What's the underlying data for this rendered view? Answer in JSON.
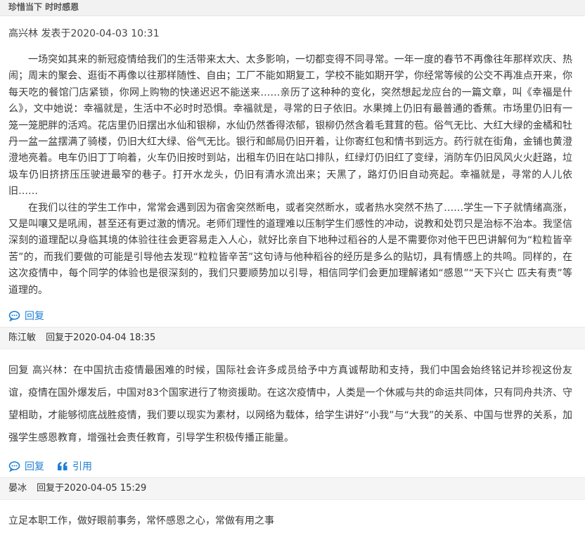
{
  "topic": {
    "title": "珍惜当下 时时感恩"
  },
  "post": {
    "author": "高兴林",
    "meta": "发表于2020-04-03 10:31",
    "paragraphs": [
      "一场突如其来的新冠疫情给我们的生活带来太大、太多影响，一切都变得不同寻常。一年一度的春节不再像往年那样欢庆、热闹；周末的聚会、逛街不再像以往那样随性、自由；工厂不能如期复工，学校不能如期开学，你经常等候的公交不再准点开来，你每天吃的餐馆门店紧锁，你网上购物的快递迟迟不能送来……亲历了这种种的变化，突然想起龙应台的一篇文章，叫《幸福是什么》，文中她说：幸福就是，生活中不必时时恐惧。幸福就是，寻常的日子依旧。水果摊上仍旧有最普通的香蕉。市场里仍旧有一笼一笼肥胖的活鸡。花店里仍旧摆出水仙和银柳，水仙仍然香得浓郁，银柳仍然含着毛茸茸的苞。俗气无比、大红大绿的金橘和牡丹一盆一盆摆满了骑楼，仍旧大红大绿、俗气无比。银行和邮局仍旧开着，让你寄红包和情书到远方。药行就在街角，金铺也黄澄澄地亮着。电车仍旧丁丁响着，火车仍旧按时到站，出租车仍旧在站口排队，红绿灯仍旧红了变绿，消防车仍旧风风火火赶路，垃圾车仍旧挤挤压压驶进最窄的巷子。打开水龙头，仍旧有清水流出来；天黑了，路灯仍旧自动亮起。幸福就是，寻常的人儿依旧……",
      "在我们以往的学生工作中，常常会遇到因为宿舍突然断电，或者突然断水，或者热水突然不热了……学生一下子就情绪高涨，又是叫嚷又是吼闹，甚至还有更过激的情况。老师们理性的道理难以压制学生们感性的冲动，说教和处罚只是治标不治本。我坚信深刻的道理配以身临其境的体验往往会更容易走入人心，就好比亲自下地种过稻谷的人是不需要你对他干巴巴讲解何为“粒粒皆辛苦”的，而我们要做的可能是引导他去发现“粒粒皆辛苦”这句诗与他种稻谷的经历是多么的贴切，具有情感上的共鸣。同样的，在这次疫情中，每个同学的体验也是很深刻的，我们只要顺势加以引导，相信同学们会更加理解诸如“感恩”“天下兴亡 匹夫有责”等道理的。"
    ],
    "reply_label": "回复"
  },
  "replies": [
    {
      "author": "陈江敏",
      "meta": "回复于2020-04-04 18:35",
      "text": "回复 高兴林：在中国抗击疫情最困难的时候，国际社会许多成员给予中方真诚帮助和支持，我们中国会始终铭记并珍视这份友谊，疫情在国外爆发后，中国对83个国家进行了物资援助。在这次疫情中，人类是一个休戚与共的命运共同体，只有同舟共济、守望相助，才能够彻底战胜疫情，我们要以现实为素材，以网络为载体，给学生讲好“小我”与“大我”的关系、中国与世界的关系，加强学生感恩教育，增强社会责任教育，引导学生积极传播正能量。",
      "reply_label": "回复",
      "quote_label": "引用"
    },
    {
      "author": "晏冰",
      "meta": "回复于2020-04-05 15:29",
      "text": "立足本职工作，做好眼前事务，常怀感恩之心，常做有用之事"
    }
  ],
  "colors": {
    "link": "#1f7fd4",
    "bar": "#f5f5f5"
  },
  "icons": {
    "reply": "comment-icon",
    "quote": "quote-icon"
  }
}
